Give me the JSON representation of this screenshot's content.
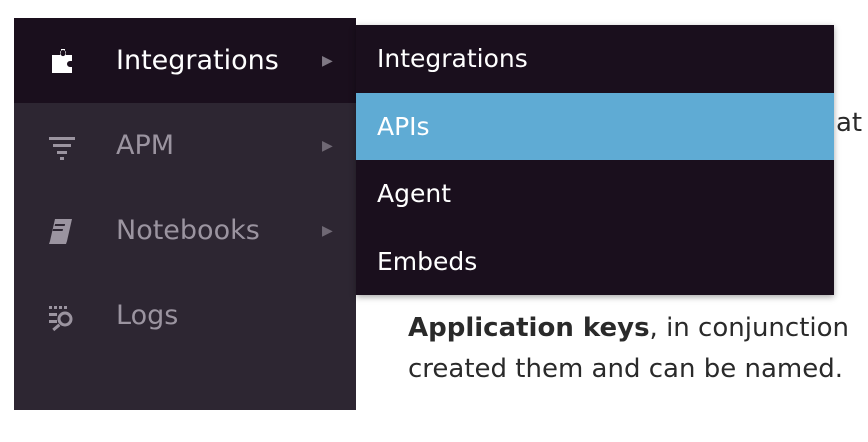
{
  "sidebar": {
    "items": [
      {
        "label": "Integrations",
        "icon": "puzzle-icon",
        "active": true,
        "has_submenu": true
      },
      {
        "label": "APM",
        "icon": "apm-filter-icon",
        "active": false,
        "has_submenu": true
      },
      {
        "label": "Notebooks",
        "icon": "notebook-icon",
        "active": false,
        "has_submenu": true
      },
      {
        "label": "Logs",
        "icon": "logs-icon",
        "active": false,
        "has_submenu": false
      }
    ]
  },
  "submenu": {
    "items": [
      {
        "label": "Integrations",
        "selected": false
      },
      {
        "label": "APIs",
        "selected": true
      },
      {
        "label": "Agent",
        "selected": false
      },
      {
        "label": "Embeds",
        "selected": false
      }
    ]
  },
  "page": {
    "peek_text": "at",
    "paragraph_bold": "Application keys",
    "paragraph_rest_line1": ", in conjunction",
    "paragraph_line2": "created them and can be named."
  },
  "colors": {
    "sidebar_bg": "#2d2632",
    "active_bg": "#1a0f1d",
    "selected_bg": "#5fabd4"
  }
}
